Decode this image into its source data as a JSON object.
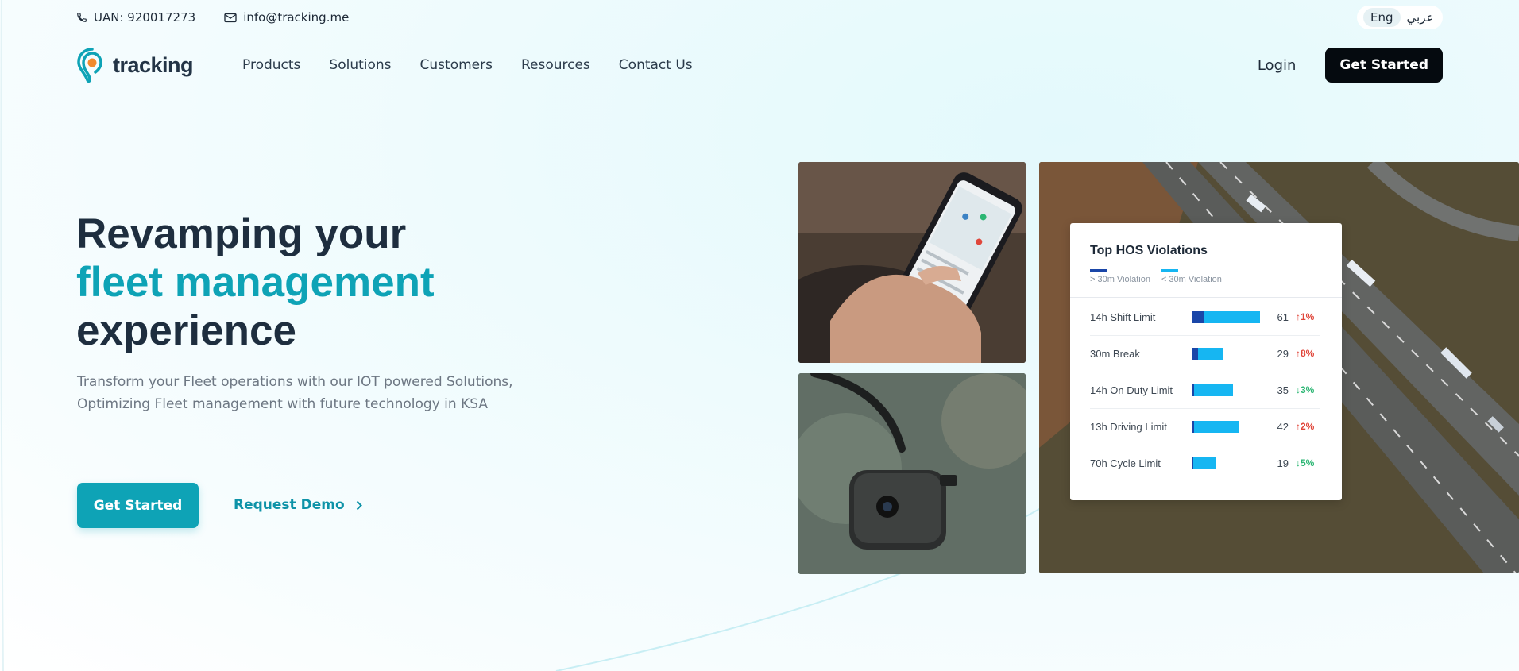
{
  "topbar": {
    "phone": "UAN: 920017273",
    "email": "info@tracking.me",
    "lang_en": "Eng",
    "lang_ar": "عربي"
  },
  "nav": {
    "logo": "tracking",
    "items": [
      "Products",
      "Solutions",
      "Customers",
      "Resources",
      "Contact Us"
    ],
    "login": "Login",
    "cta": "Get Started"
  },
  "hero": {
    "title_line1": "Revamping your",
    "title_accent": "fleet management",
    "title_line3": "experience",
    "subtitle_line1": "Transform your Fleet operations with our IOT powered Solutions,",
    "subtitle_line2": "Optimizing Fleet management with future technology in KSA",
    "primary_cta": "Get Started",
    "secondary_cta": "Request Demo"
  },
  "card": {
    "title": "Top HOS Violations",
    "legend": [
      {
        "label": "> 30m Violation",
        "color": "#1a46a8"
      },
      {
        "label": "< 30m Violation",
        "color": "#16b6f2"
      }
    ],
    "rows": [
      {
        "label": "14h Shift Limit",
        "over": 0.19,
        "under": 0.81,
        "total": 61,
        "change": "1%",
        "dir": "up"
      },
      {
        "label": "30m Break",
        "over": 0.09,
        "under": 0.38,
        "total": 29,
        "change": "8%",
        "dir": "up"
      },
      {
        "label": "14h On Duty Limit",
        "over": 0.04,
        "under": 0.56,
        "total": 35,
        "change": "3%",
        "dir": "down"
      },
      {
        "label": "13h Driving Limit",
        "over": 0.04,
        "under": 0.65,
        "total": 42,
        "change": "2%",
        "dir": "up"
      },
      {
        "label": "70h Cycle Limit",
        "over": 0.02,
        "under": 0.32,
        "total": 19,
        "change": "5%",
        "dir": "down"
      }
    ]
  },
  "colors": {
    "accent": "#0ea3b6",
    "dark": "#050a0f",
    "up": "#e0463a",
    "down": "#2bb673"
  }
}
